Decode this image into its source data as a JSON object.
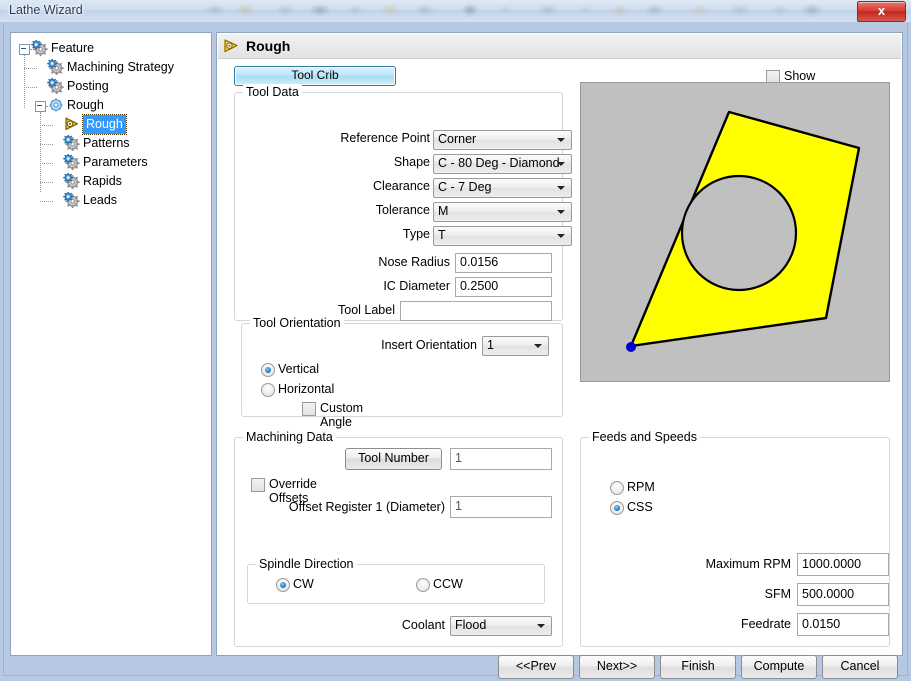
{
  "window": {
    "title": "Lathe Wizard",
    "close_label": "x"
  },
  "tree": {
    "items": [
      {
        "label": "Feature",
        "icon": "gear-icon",
        "depth": 0,
        "expander": true,
        "selected": false
      },
      {
        "label": "Machining Strategy",
        "icon": "gear-icon",
        "depth": 1,
        "expander": false,
        "selected": false
      },
      {
        "label": "Posting",
        "icon": "gear-icon",
        "depth": 1,
        "expander": false,
        "selected": false
      },
      {
        "label": "Rough",
        "icon": "gear-blue-icon",
        "depth": 1,
        "expander": true,
        "selected": false
      },
      {
        "label": "Rough",
        "icon": "tool-icon",
        "depth": 2,
        "expander": false,
        "selected": true
      },
      {
        "label": "Patterns",
        "icon": "gear-icon",
        "depth": 2,
        "expander": false,
        "selected": false
      },
      {
        "label": "Parameters",
        "icon": "gear-icon",
        "depth": 2,
        "expander": false,
        "selected": false
      },
      {
        "label": "Rapids",
        "icon": "gear-icon",
        "depth": 2,
        "expander": false,
        "selected": false
      },
      {
        "label": "Leads",
        "icon": "gear-icon",
        "depth": 2,
        "expander": false,
        "selected": false
      }
    ]
  },
  "page": {
    "header_title": "Rough",
    "tool_crib_button": "Tool Crib",
    "show_tool_holder": {
      "label": "Show Tool Holder",
      "checked": false
    }
  },
  "tool_data": {
    "group_title": "Tool Data",
    "reference_point": {
      "label": "Reference Point",
      "value": "Corner"
    },
    "shape": {
      "label": "Shape",
      "value": "C - 80 Deg - Diamond"
    },
    "clearance": {
      "label": "Clearance",
      "value": "C - 7 Deg"
    },
    "tolerance": {
      "label": "Tolerance",
      "value": "M"
    },
    "type": {
      "label": "Type",
      "value": "T"
    },
    "nose_radius": {
      "label": "Nose Radius",
      "value": "0.0156"
    },
    "ic_diameter": {
      "label": "IC Diameter",
      "value": "0.2500"
    },
    "tool_label": {
      "label": "Tool Label",
      "value": ""
    }
  },
  "tool_orientation": {
    "group_title": "Tool Orientation",
    "insert_orientation": {
      "label": "Insert Orientation",
      "value": "1"
    },
    "vertical": {
      "label": "Vertical",
      "selected": true
    },
    "horizontal": {
      "label": "Horizontal",
      "selected": false
    },
    "custom_angle": {
      "label": "Custom Angle",
      "checked": false
    }
  },
  "machining_data": {
    "group_title": "Machining Data",
    "tool_number_button": "Tool Number",
    "tool_number_value": "1",
    "override_offsets": {
      "label": "Override Offsets",
      "checked": false
    },
    "offset_register": {
      "label": "Offset Register 1 (Diameter)",
      "value": "1"
    },
    "spindle_direction": {
      "group_title": "Spindle Direction",
      "cw": {
        "label": "CW",
        "selected": true
      },
      "ccw": {
        "label": "CCW",
        "selected": false
      }
    },
    "coolant": {
      "label": "Coolant",
      "value": "Flood"
    }
  },
  "feeds_and_speeds": {
    "group_title": "Feeds and Speeds",
    "rpm": {
      "label": "RPM",
      "selected": false
    },
    "css": {
      "label": "CSS",
      "selected": true
    },
    "maximum_rpm": {
      "label": "Maximum RPM",
      "value": "1000.0000"
    },
    "sfm": {
      "label": "SFM",
      "value": "500.0000"
    },
    "feedrate": {
      "label": "Feedrate",
      "value": "0.0150"
    }
  },
  "preview": {
    "insert_color": "#ffff00",
    "background_color": "#c0c0c0",
    "outline_color": "#000000",
    "reference_point_color": "#0000cc",
    "hole_color": "#c0c0c0"
  },
  "footer": {
    "buttons": [
      {
        "label": "<<Prev"
      },
      {
        "label": "Next>>"
      },
      {
        "label": "Finish"
      },
      {
        "label": "Compute"
      },
      {
        "label": "Cancel"
      }
    ]
  }
}
